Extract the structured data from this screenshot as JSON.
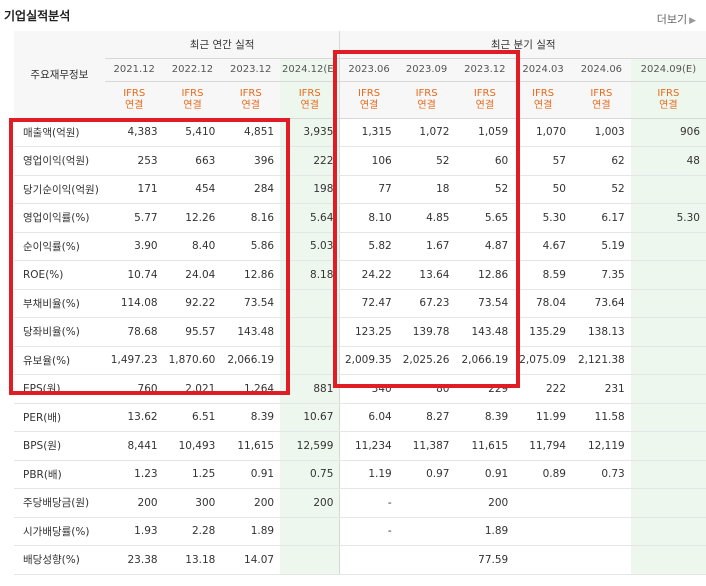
{
  "page": {
    "title": "기업실적분석",
    "more": "더보기"
  },
  "header": {
    "row_label": "주요재무정보",
    "annual_title": "최근 연간 실적",
    "quarterly_title": "최근 분기 실적",
    "periods": [
      "2021.12",
      "2022.12",
      "2023.12",
      "2024.12(E)",
      "2023.06",
      "2023.09",
      "2023.12",
      "2024.03",
      "2024.06",
      "2024.09(E)"
    ],
    "ifrs_top": "IFRS",
    "ifrs_bottom": "연결"
  },
  "rows": [
    {
      "label": "매출액(억원)",
      "values": [
        "4,383",
        "5,410",
        "4,851",
        "3,935",
        "1,315",
        "1,072",
        "1,059",
        "1,070",
        "1,003",
        "906"
      ]
    },
    {
      "label": "영업이익(억원)",
      "values": [
        "253",
        "663",
        "396",
        "222",
        "106",
        "52",
        "60",
        "57",
        "62",
        "48"
      ]
    },
    {
      "label": "당기순이익(억원)",
      "values": [
        "171",
        "454",
        "284",
        "198",
        "77",
        "18",
        "52",
        "50",
        "52",
        ""
      ]
    },
    {
      "label": "영업이익률(%)",
      "values": [
        "5.77",
        "12.26",
        "8.16",
        "5.64",
        "8.10",
        "4.85",
        "5.65",
        "5.30",
        "6.17",
        "5.30"
      ]
    },
    {
      "label": "순이익률(%)",
      "values": [
        "3.90",
        "8.40",
        "5.86",
        "5.03",
        "5.82",
        "1.67",
        "4.87",
        "4.67",
        "5.19",
        ""
      ]
    },
    {
      "label": "ROE(%)",
      "values": [
        "10.74",
        "24.04",
        "12.86",
        "8.18",
        "24.22",
        "13.64",
        "12.86",
        "8.59",
        "7.35",
        ""
      ]
    },
    {
      "label": "부채비율(%)",
      "values": [
        "114.08",
        "92.22",
        "73.54",
        "",
        "72.47",
        "67.23",
        "73.54",
        "78.04",
        "73.64",
        ""
      ]
    },
    {
      "label": "당좌비율(%)",
      "values": [
        "78.68",
        "95.57",
        "143.48",
        "",
        "123.25",
        "139.78",
        "143.48",
        "135.29",
        "138.13",
        ""
      ]
    },
    {
      "label": "유보율(%)",
      "values": [
        "1,497.23",
        "1,870.60",
        "2,066.19",
        "",
        "2,009.35",
        "2,025.26",
        "2,066.19",
        "2,075.09",
        "2,121.38",
        ""
      ]
    },
    {
      "label": "EPS(원)",
      "values": [
        "760",
        "2,021",
        "1,264",
        "881",
        "340",
        "80",
        "229",
        "222",
        "231",
        ""
      ]
    },
    {
      "label": "PER(배)",
      "values": [
        "13.62",
        "6.51",
        "8.39",
        "10.67",
        "6.04",
        "8.27",
        "8.39",
        "11.99",
        "11.58",
        ""
      ]
    },
    {
      "label": "BPS(원)",
      "values": [
        "8,441",
        "10,493",
        "11,615",
        "12,599",
        "11,234",
        "11,387",
        "11,615",
        "11,794",
        "12,119",
        ""
      ]
    },
    {
      "label": "PBR(배)",
      "values": [
        "1.23",
        "1.25",
        "0.91",
        "0.75",
        "1.19",
        "0.97",
        "0.91",
        "0.89",
        "0.73",
        ""
      ]
    },
    {
      "label": "주당배당금(원)",
      "values": [
        "200",
        "300",
        "200",
        "200",
        "-",
        "",
        "200",
        "",
        "",
        ""
      ]
    },
    {
      "label": "시가배당률(%)",
      "values": [
        "1.93",
        "2.28",
        "1.89",
        "",
        "-",
        "",
        "1.89",
        "",
        "",
        ""
      ]
    },
    {
      "label": "배당성향(%)",
      "values": [
        "23.38",
        "13.18",
        "14.07",
        "",
        "",
        "",
        "77.59",
        "",
        "",
        ""
      ]
    }
  ],
  "colors": {
    "highlight": "#e01c24",
    "ifrs": "#e8691a",
    "estimate_bg": "#eef7ee"
  }
}
